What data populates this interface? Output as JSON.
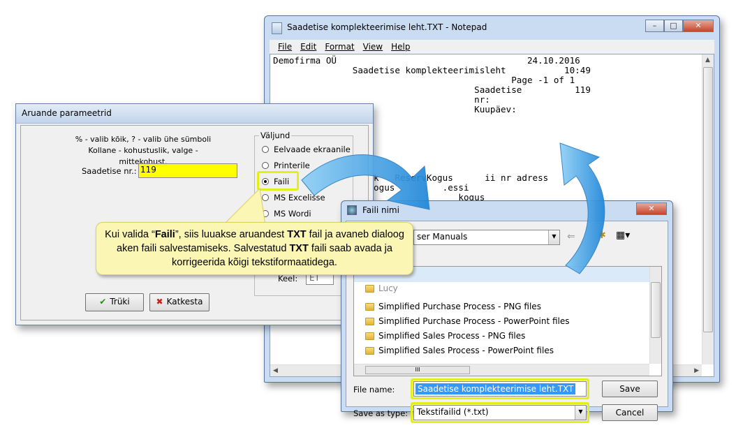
{
  "notepad": {
    "title": "Saadetise komplekteerimise leht.TXT - Notepad",
    "menu": [
      "File",
      "Edit",
      "Format",
      "View",
      "Help"
    ],
    "content": "Demofirma OÜ                                    24.10.2016\n               Saadetise komplekteerimisleht           10:49\n                                             Page -1 of 1\n                                      Saadetise          119\n                                      nr:\n                                      Kuupäev:\n\n\n\n,\n\n\n              ajalik   ReservKogus      ii nr adress\n           ll     kogus         .essi\n                                   kogus\n\n"
  },
  "params": {
    "title": "Aruande parameetrid",
    "help1": "% - valib kõik, ? - valib ühe sümboli",
    "help2": "Kollane - kohustuslik, valge - mittekohust.",
    "field_label": "Saadetise nr.:",
    "field_value": "119",
    "group_label": "Väljund",
    "options": [
      "Eelvaade ekraanile",
      "Printerile",
      "Faili",
      "MS Excelisse",
      "MS Wordi"
    ],
    "selected": "Faili",
    "lang_label": "Keel:",
    "lang_value": "ET",
    "print": "Trüki",
    "cancel": "Katkesta"
  },
  "save": {
    "title": "Faili nimi",
    "location": "ser Manuals",
    "items": [
      "Simplified Purchase Process - PNG files",
      "Simplified Purchase Process - PowerPoint files",
      "Simplified Sales Process - PNG files",
      "Simplified Sales Process - PowerPoint files"
    ],
    "partial_item": "Lucy",
    "filename_label": "File name:",
    "filename": "Saadetise komplekteerimise leht.TXT",
    "type_label": "Save as type:",
    "type": "Tekstifailid (*.txt)",
    "save_btn": "Save",
    "cancel_btn": "Cancel",
    "hscroll": "III"
  },
  "callout": {
    "a": "Kui valida “",
    "b": "Faili",
    "c": "”, siis luuakse aruandest ",
    "d": "TXT",
    "e": " fail ja avaneb dialoog aken faili salvestamiseks. Salvestatud ",
    "f": "TXT",
    "g": " faili saab avada ja korrigeerida kõigi tekstiformaatidega."
  },
  "colors": {
    "highlight": "#e3ef1a",
    "required_field": "#ffff00",
    "arrow": "#3aa0e6"
  }
}
